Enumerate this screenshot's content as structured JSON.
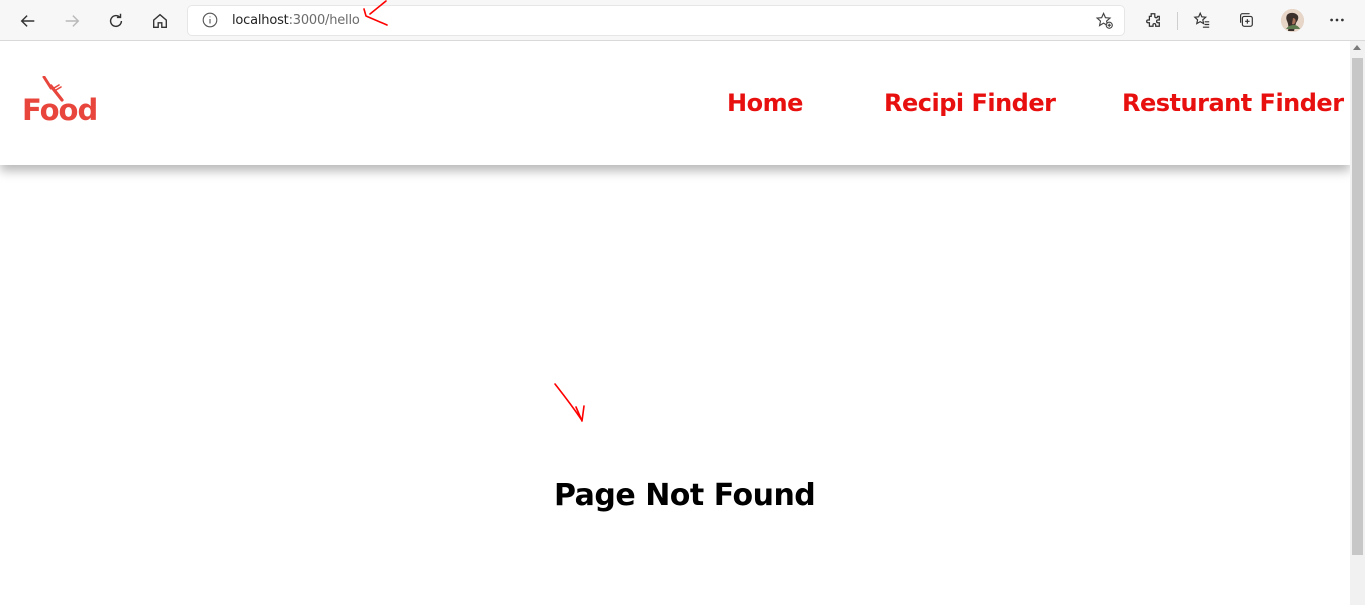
{
  "browser": {
    "url_host": "localhost",
    "url_rest": ":3000/hello",
    "icons": [
      "back-arrow-icon",
      "forward-arrow-icon",
      "refresh-icon",
      "home-icon",
      "info-icon",
      "favorite-add-icon",
      "extensions-icon",
      "favorites-icon",
      "collections-icon",
      "profile-avatar",
      "more-icon"
    ]
  },
  "header": {
    "logo_text": "Food",
    "nav": {
      "home": "Home",
      "recipe_finder": "Recipi Finder",
      "restaurant_finder": "Resturant Finder"
    }
  },
  "main": {
    "message": "Page Not Found"
  },
  "colors": {
    "accent_red": "#e80f0f",
    "logo_red": "#e8453c",
    "annotation_red": "#ff0000"
  }
}
